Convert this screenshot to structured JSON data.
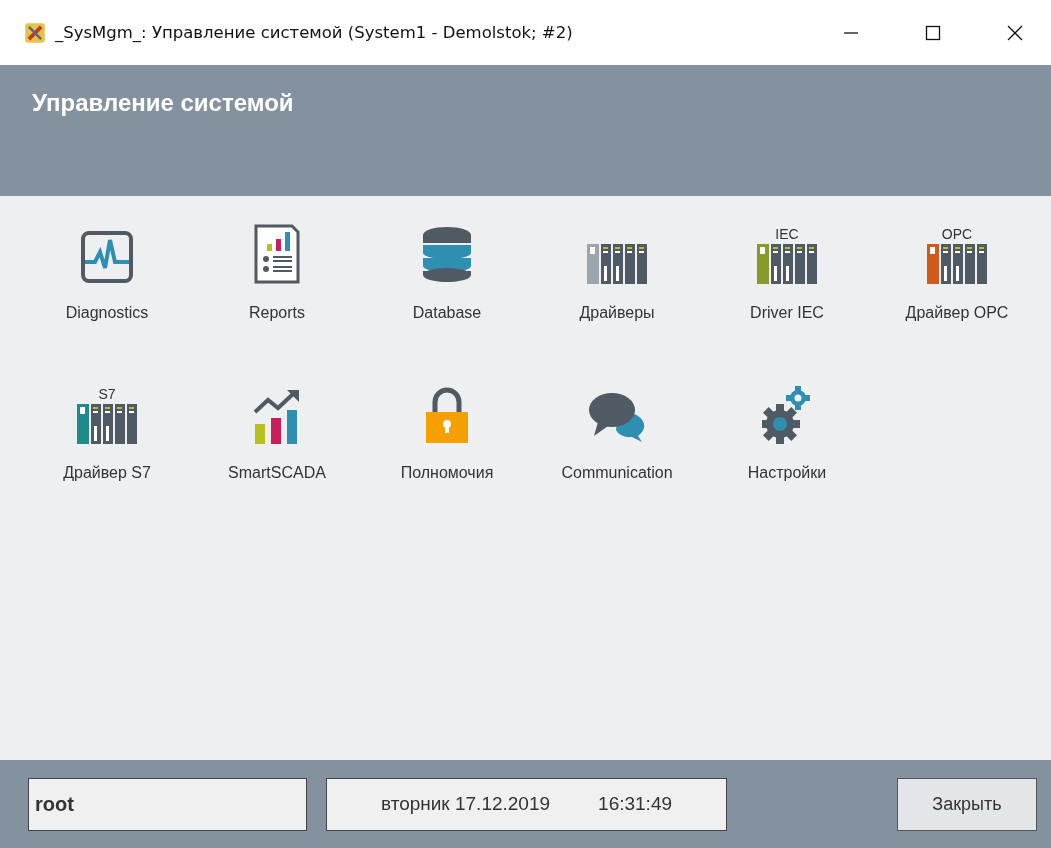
{
  "window": {
    "title": "_SysMgm_: Управление системой (System1 - Demolstok; #2)"
  },
  "header": {
    "title": "Управление системой"
  },
  "tiles": [
    {
      "label": "Diagnostics",
      "kind": "monitor"
    },
    {
      "label": "Reports",
      "kind": "report"
    },
    {
      "label": "Database",
      "kind": "database"
    },
    {
      "label": "Драйверы",
      "kind": "rack",
      "color": "#9aa5ad"
    },
    {
      "label": "Driver IEC",
      "kind": "rack",
      "color": "#8a9a2a",
      "caption": "IEC"
    },
    {
      "label": "Драйвер OPC",
      "kind": "rack",
      "color": "#d05a1a",
      "caption": "OPC"
    },
    {
      "label": "Драйвер S7",
      "kind": "rack",
      "color": "#1e8a8a",
      "caption": "S7"
    },
    {
      "label": "SmartSCADA",
      "kind": "trend"
    },
    {
      "label": "Полномочия",
      "kind": "lock"
    },
    {
      "label": "Communication",
      "kind": "chat"
    },
    {
      "label": "Настройки",
      "kind": "gears"
    }
  ],
  "footer": {
    "user": "root",
    "date": "вторник 17.12.2019",
    "time": "16:31:49",
    "close_button": "Закрыть"
  }
}
